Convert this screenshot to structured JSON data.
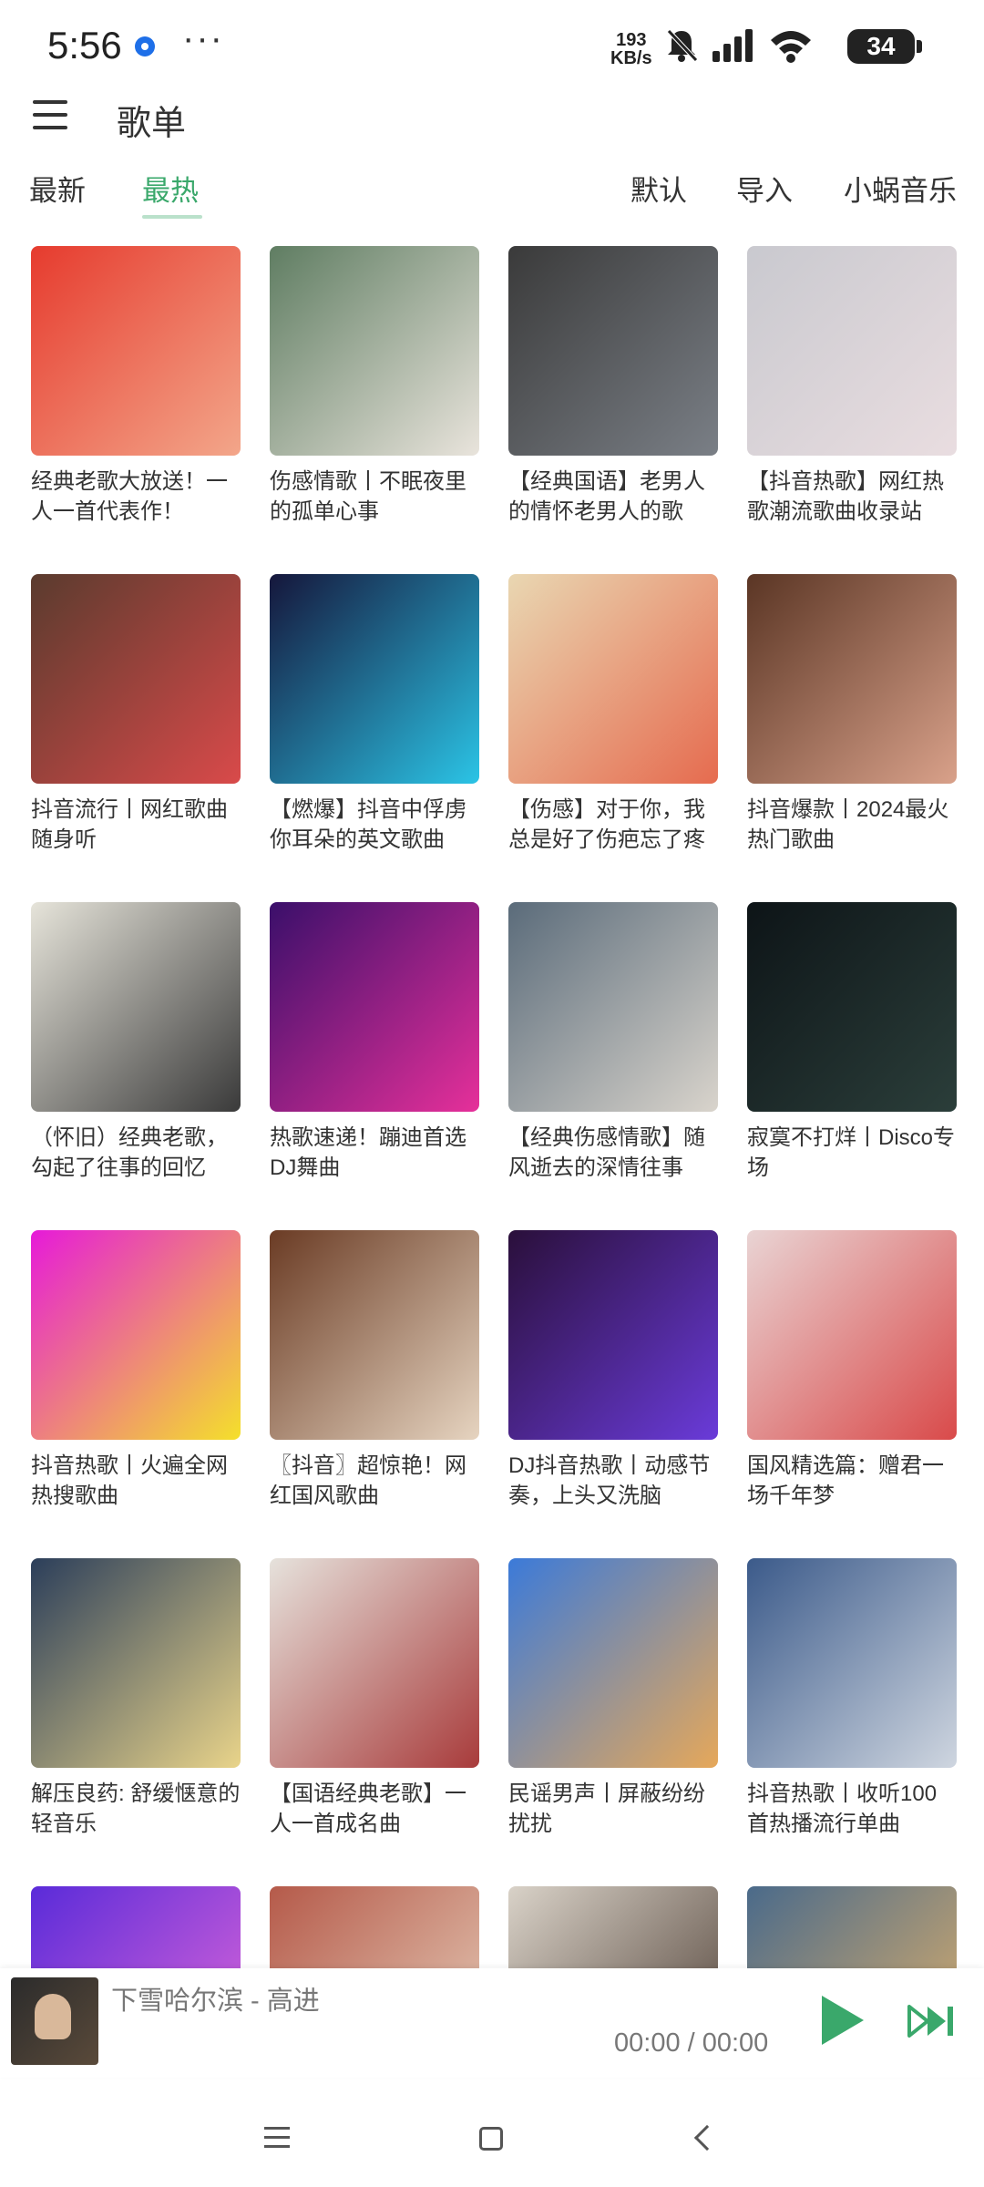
{
  "status_bar": {
    "time": "5:56",
    "more": "···",
    "net_speed_value": "193",
    "net_speed_unit": "KB/s",
    "battery": "34"
  },
  "header": {
    "title": "歌单",
    "menu_icon": "hamburger-menu-icon"
  },
  "tabs": [
    {
      "label": "最新",
      "active": false
    },
    {
      "label": "最热",
      "active": true
    },
    {
      "label": "默认",
      "active": false
    },
    {
      "label": "导入",
      "active": false
    },
    {
      "label": "小蜗音乐",
      "active": false
    }
  ],
  "playlists": [
    {
      "title": "经典老歌大放送！一人一首代表作！",
      "colors": [
        "#e63b2e",
        "#f3a68a"
      ]
    },
    {
      "title": "伤感情歌丨不眠夜里的孤单心事",
      "colors": [
        "#5f7d62",
        "#e9e4dc"
      ]
    },
    {
      "title": "【经典国语】老男人的情怀老男人的歌",
      "colors": [
        "#3a3a3a",
        "#7a7f86"
      ]
    },
    {
      "title": "【抖音热歌】网红热歌潮流歌曲收录站",
      "colors": [
        "#c9c9cf",
        "#e9dde0"
      ]
    },
    {
      "title": "抖音流行丨网红歌曲随身听",
      "colors": [
        "#5a3b2e",
        "#d94a4a"
      ]
    },
    {
      "title": "【燃爆】抖音中俘虏你耳朵的英文歌曲",
      "colors": [
        "#15163b",
        "#2bc4e6"
      ]
    },
    {
      "title": "【伤感】对于你，我总是好了伤疤忘了疼",
      "colors": [
        "#e9d7b2",
        "#e66b4f"
      ]
    },
    {
      "title": "抖音爆款丨2024最火热门歌曲",
      "colors": [
        "#5a3524",
        "#d9a18a"
      ]
    },
    {
      "title": "（怀旧）经典老歌，勾起了往事的回忆",
      "colors": [
        "#e6e4da",
        "#3a3a3a"
      ]
    },
    {
      "title": "热歌速递！蹦迪首选DJ舞曲",
      "colors": [
        "#3a0f6a",
        "#e6309a"
      ]
    },
    {
      "title": "【经典伤感情歌】随风逝去的深情往事",
      "colors": [
        "#5a6b7a",
        "#d9d4cc"
      ]
    },
    {
      "title": "寂寞不打烊丨Disco专场",
      "colors": [
        "#0d1417",
        "#2b3e3a"
      ]
    },
    {
      "title": "抖音热歌丨火遍全网热搜歌曲",
      "colors": [
        "#e61ad9",
        "#f4e02b"
      ]
    },
    {
      "title": "〖抖音〗超惊艳！网红国风歌曲",
      "colors": [
        "#6a3b24",
        "#e6d4c0"
      ]
    },
    {
      "title": "DJ抖音热歌丨动感节奏，上头又洗脑",
      "colors": [
        "#2a0f3a",
        "#6a3bd9"
      ]
    },
    {
      "title": "国风精选篇：赠君一场千年梦",
      "colors": [
        "#e9d4d4",
        "#d94a4a"
      ]
    },
    {
      "title": "解压良药: 舒缓惬意的轻音乐",
      "colors": [
        "#2b3e5a",
        "#e9d48a"
      ]
    },
    {
      "title": "【国语经典老歌】一人一首成名曲",
      "colors": [
        "#e6e2dc",
        "#a83b3b"
      ]
    },
    {
      "title": "民谣男声丨屏蔽纷纷扰扰",
      "colors": [
        "#3b7ad9",
        "#e6a85a"
      ]
    },
    {
      "title": "抖音热歌丨收听100首热播流行单曲",
      "colors": [
        "#3b5a8a",
        "#cfd6e0"
      ]
    },
    {
      "title": "",
      "colors": [
        "#5a2bd9",
        "#e66bd9"
      ]
    },
    {
      "title": "",
      "colors": [
        "#b55a4a",
        "#e9d4c0"
      ]
    },
    {
      "title": "",
      "colors": [
        "#d9d2c8",
        "#4a3a30"
      ]
    },
    {
      "title": "",
      "colors": [
        "#4a6a8a",
        "#e6b46a"
      ]
    }
  ],
  "player": {
    "song": "下雪哈尔滨 - 高进",
    "time": "00:00 / 00:00",
    "accent_color": "#3aa86b"
  }
}
